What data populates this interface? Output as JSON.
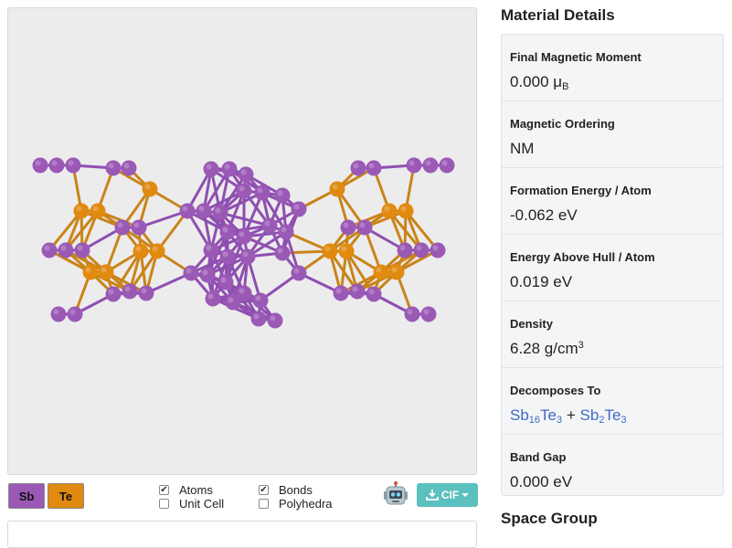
{
  "viewer": {
    "legend": [
      {
        "label": "Sb",
        "color": "#9b59b6"
      },
      {
        "label": "Te",
        "color": "#e08a10"
      }
    ],
    "toggles": {
      "atoms": {
        "label": "Atoms",
        "checked": true
      },
      "unit_cell": {
        "label": "Unit Cell",
        "checked": false
      },
      "bonds": {
        "label": "Bonds",
        "checked": true
      },
      "polyhedra": {
        "label": "Polyhedra",
        "checked": false
      }
    },
    "robot_icon": "robot-icon",
    "export_button": {
      "label": "CIF",
      "icon": "download-icon",
      "caret": "chevron-down-icon"
    }
  },
  "details": {
    "title": "Material Details",
    "rows": {
      "magnetic_moment": {
        "label": "Final Magnetic Moment",
        "value": "0.000 ",
        "unit": "μ",
        "unit_sub": "B"
      },
      "magnetic_ordering": {
        "label": "Magnetic Ordering",
        "value": "NM"
      },
      "formation_energy": {
        "label": "Formation Energy / Atom",
        "value": "-0.062 eV"
      },
      "energy_above_hull": {
        "label": "Energy Above Hull / Atom",
        "value": "0.019 eV"
      },
      "density": {
        "label": "Density",
        "value": "6.28 g/cm",
        "sup": "3"
      },
      "decomposes_to": {
        "label": "Decomposes To",
        "plus": " + ",
        "products": [
          {
            "el1": "Sb",
            "n1": "16",
            "el2": "Te",
            "n2": "3"
          },
          {
            "el1": "Sb",
            "n1": "2",
            "el2": "Te",
            "n2": "3"
          }
        ]
      },
      "band_gap": {
        "label": "Band Gap",
        "value": "0.000 eV"
      }
    }
  },
  "space_group": {
    "title": "Space Group"
  }
}
